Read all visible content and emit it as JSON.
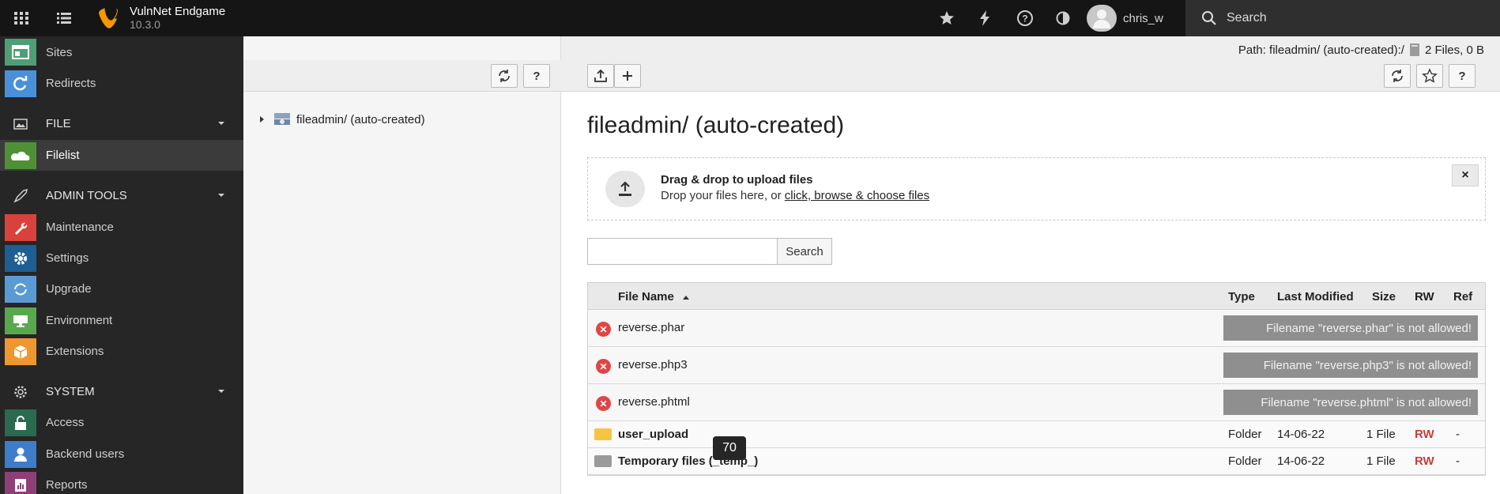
{
  "app": {
    "name": "VulnNet Endgame",
    "version": "10.3.0",
    "user": "chris_w",
    "search_label": "Search"
  },
  "sidebar": {
    "items": [
      {
        "label": "Sites",
        "icon": "sites-icon",
        "color": "#4f9e78"
      },
      {
        "label": "Redirects",
        "icon": "redirect-icon",
        "color": "#4a90d9"
      },
      {
        "label": "FILE",
        "group": true,
        "icon": "image-icon"
      },
      {
        "label": "Filelist",
        "icon": "filelist-icon",
        "color": "#4f8f35",
        "active": true
      },
      {
        "label": "ADMIN TOOLS",
        "group": true,
        "icon": "rocket-icon"
      },
      {
        "label": "Maintenance",
        "icon": "wrench-icon",
        "color": "#d9423c"
      },
      {
        "label": "Settings",
        "icon": "gear-icon",
        "color": "#1d5e94"
      },
      {
        "label": "Upgrade",
        "icon": "upgrade-icon",
        "color": "#5b9bd5"
      },
      {
        "label": "Environment",
        "icon": "environment-icon",
        "color": "#59a84e"
      },
      {
        "label": "Extensions",
        "icon": "extensions-icon",
        "color": "#f0962e"
      },
      {
        "label": "SYSTEM",
        "group": true,
        "icon": "system-gear-icon"
      },
      {
        "label": "Access",
        "icon": "lock-icon",
        "color": "#2a6b4f"
      },
      {
        "label": "Backend users",
        "icon": "user-icon",
        "color": "#3e7dc9"
      },
      {
        "label": "Reports",
        "icon": "reports-icon",
        "color": "#8e3f77"
      }
    ]
  },
  "tree": {
    "root": "fileadmin/ (auto-created)"
  },
  "header": {
    "path_label": "Path: fileadmin/ (auto-created):/",
    "file_count": "2 Files, 0 B"
  },
  "main": {
    "title": "fileadmin/ (auto-created)",
    "dropzone": {
      "title": "Drag & drop to upload files",
      "text": "Drop your files here, or ",
      "link": "click, browse & choose files",
      "close": "×"
    },
    "search_placeholder": "",
    "search_button": "Search"
  },
  "table": {
    "headers": [
      "File Name",
      "Type",
      "Last Modified",
      "Size",
      "RW",
      "Ref"
    ],
    "error_rows": [
      {
        "name": "reverse.phar",
        "message": "Filename \"reverse.phar\" is not allowed!"
      },
      {
        "name": "reverse.php3",
        "message": "Filename \"reverse.php3\" is not allowed!"
      },
      {
        "name": "reverse.phtml",
        "message": "Filename \"reverse.phtml\" is not allowed!"
      }
    ],
    "folder_rows": [
      {
        "name": "user_upload",
        "type": "Folder",
        "modified": "14-06-22",
        "size": "1 File",
        "rw": "RW",
        "ref": "-",
        "color": "#f5c542"
      },
      {
        "name": "Temporary files (_temp_)",
        "type": "Folder",
        "modified": "14-06-22",
        "size": "1 File",
        "rw": "RW",
        "ref": "-",
        "color": "#9a9a9a"
      }
    ]
  },
  "tooltip": "70"
}
